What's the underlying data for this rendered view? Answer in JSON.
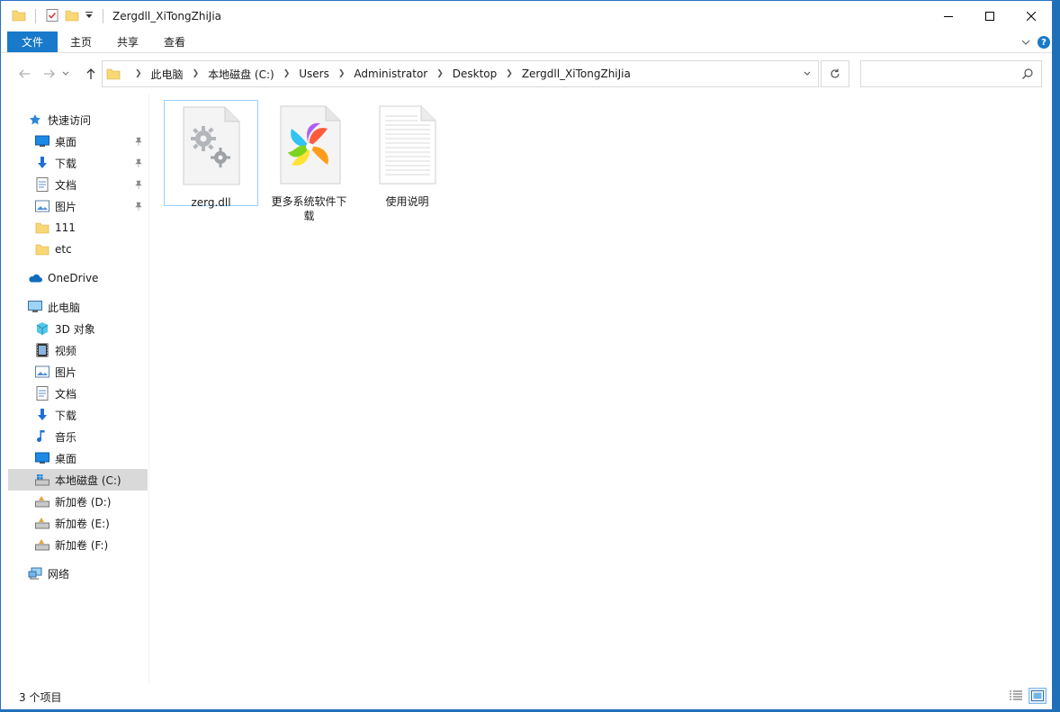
{
  "window": {
    "title": "Zergdll_XiTongZhiJia"
  },
  "ribbon": {
    "tabs": [
      "文件",
      "主页",
      "共享",
      "查看"
    ]
  },
  "address": {
    "crumbs": [
      "此电脑",
      "本地磁盘 (C:)",
      "Users",
      "Administrator",
      "Desktop",
      "Zergdll_XiTongZhiJia"
    ]
  },
  "search": {
    "placeholder": ""
  },
  "sidebar": {
    "quick_access": "快速访问",
    "quick_items": [
      "桌面",
      "下载",
      "文档",
      "图片",
      "111",
      "etc"
    ],
    "onedrive": "OneDrive",
    "this_pc": "此电脑",
    "pc_items": [
      "3D 对象",
      "视频",
      "图片",
      "文档",
      "下载",
      "音乐",
      "桌面",
      "本地磁盘 (C:)",
      "新加卷 (D:)",
      "新加卷 (E:)",
      "新加卷 (F:)"
    ],
    "network": "网络"
  },
  "files": [
    {
      "name": "zerg.dll",
      "icon": "dll-gear-icon"
    },
    {
      "name": "更多系统软件下载",
      "icon": "pinwheel-shortcut-icon"
    },
    {
      "name": "使用说明",
      "icon": "text-document-icon"
    }
  ],
  "status": {
    "item_count": "3 个项目"
  },
  "colors": {
    "accent": "#1979ca",
    "selection": "#d9d9d9",
    "desktop": "#1f6fb8"
  }
}
